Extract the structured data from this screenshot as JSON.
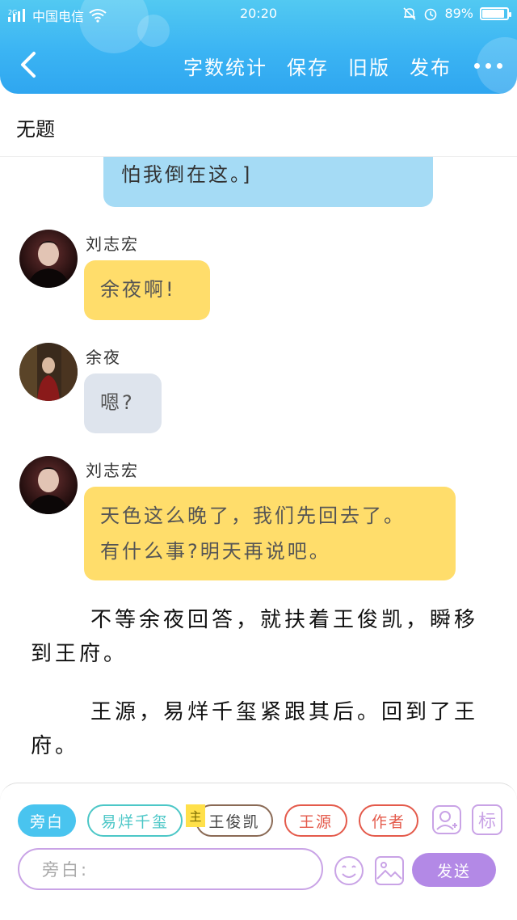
{
  "status_bar": {
    "carrier": "中国电信",
    "signal_label": "2G",
    "time": "20:20",
    "battery": "89%",
    "battery_level": 0.89
  },
  "header": {
    "actions": [
      "字数统计",
      "保存",
      "旧版",
      "发布"
    ]
  },
  "title": "无题",
  "messages": [
    {
      "type": "bubble",
      "text": "怕我倒在这。]",
      "color": "#a5dbf5"
    },
    {
      "type": "chat",
      "speaker": "刘志宏",
      "text": "余夜啊!",
      "color": "#ffdd6b"
    },
    {
      "type": "chat",
      "speaker": "余夜",
      "text": "嗯?",
      "color": "#dee4ed"
    },
    {
      "type": "chat",
      "speaker": "刘志宏",
      "lines": [
        "天色这么晚了，我们先回去了。",
        "有什么事?明天再说吧。"
      ],
      "color": "#ffdd6b"
    },
    {
      "type": "narration",
      "text": "不等余夜回答，就扶着王俊凯，瞬移到王府。"
    },
    {
      "type": "narration",
      "text": "王源，易烊千玺紧跟其后。回到了王府。"
    }
  ],
  "composer": {
    "chips": [
      "旁白",
      "易烊千玺",
      "王俊凯",
      "王源",
      "作者"
    ],
    "main_tag": "主",
    "tag_button": "标",
    "input_placeholder": "旁白:",
    "send_label": "发送"
  },
  "colors": {
    "header": "#3bb4f3",
    "accent_purple": "#b389e6",
    "narrator_chip": "#49c4ef"
  }
}
